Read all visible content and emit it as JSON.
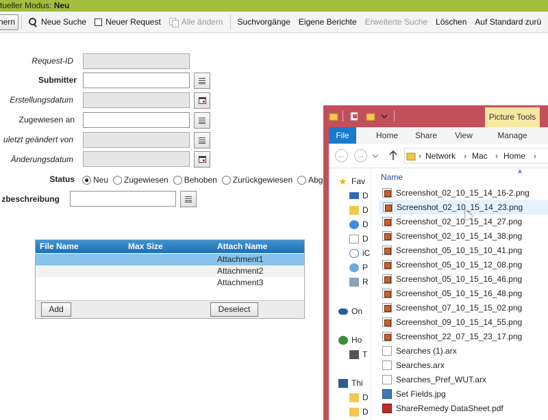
{
  "mode_bar": {
    "label": "tueller Modus:",
    "value": "Neu"
  },
  "toolbar": {
    "first_label": "hern",
    "neue_suche": "Neue Suche",
    "neuer_request": "Neuer Request",
    "alle_aendern": "Alle ändern",
    "suchvorgaenge": "Suchvorgänge",
    "eigene_berichte": "Eigene Berichte",
    "erweiterte_suche": "Erweiterte Suche",
    "loeschen": "Löschen",
    "auf_standard": "Auf Standard zurü"
  },
  "form": {
    "request_id": "Request-ID",
    "submitter": "Submitter",
    "erstellungsdatum": "Erstellungsdatum",
    "zugewiesen_an": "Zugewiesen an",
    "zuletzt_geaendert_von": "uletzt geändert von",
    "aenderungsdatum": "Änderungsdatum",
    "status": "Status",
    "kurzbeschreibung": "zbeschreibung",
    "status_options": [
      "Neu",
      "Zugewiesen",
      "Behoben",
      "Zurückgewiesen",
      "Abge"
    ],
    "status_selected": "Neu"
  },
  "attachments": {
    "columns": [
      "File Name",
      "Max Size",
      "Attach Name"
    ],
    "rows": [
      "Attachment1",
      "Attachment2",
      "Attachment3"
    ],
    "add": "Add",
    "deselect": "Deselect"
  },
  "explorer": {
    "picture_tools": "Picture Tools",
    "tabs": [
      "File",
      "Home",
      "Share",
      "View",
      "Manage"
    ],
    "address": [
      "Network",
      "Mac",
      "Home"
    ],
    "column_name": "Name",
    "nav_items": [
      "Fav",
      "D",
      "D",
      "D",
      "D",
      "iC",
      "P",
      "R",
      "On",
      "Ho",
      "T",
      "Thi",
      "D",
      "D"
    ],
    "files": [
      "Screenshot_02_10_15_14_16-2.png",
      "Screenshot_02_10_15_14_23.png",
      "Screenshot_02_10_15_14_27.png",
      "Screenshot_02_10_15_14_38.png",
      "Screenshot_05_10_15_10_41.png",
      "Screenshot_05_10_15_12_08.png",
      "Screenshot_05_10_15_16_46.png",
      "Screenshot_05_10_15_16_48.png",
      "Screenshot_07_10_15_15_02.png",
      "Screenshot_09_10_15_14_55.png",
      "Screenshot_22_07_15_23_17.png",
      "Searches (1).arx",
      "Searches.arx",
      "Searches_Pref_WUT.arx",
      "Set Fields.jpg",
      "ShareRemedy DataSheet.pdf"
    ]
  }
}
